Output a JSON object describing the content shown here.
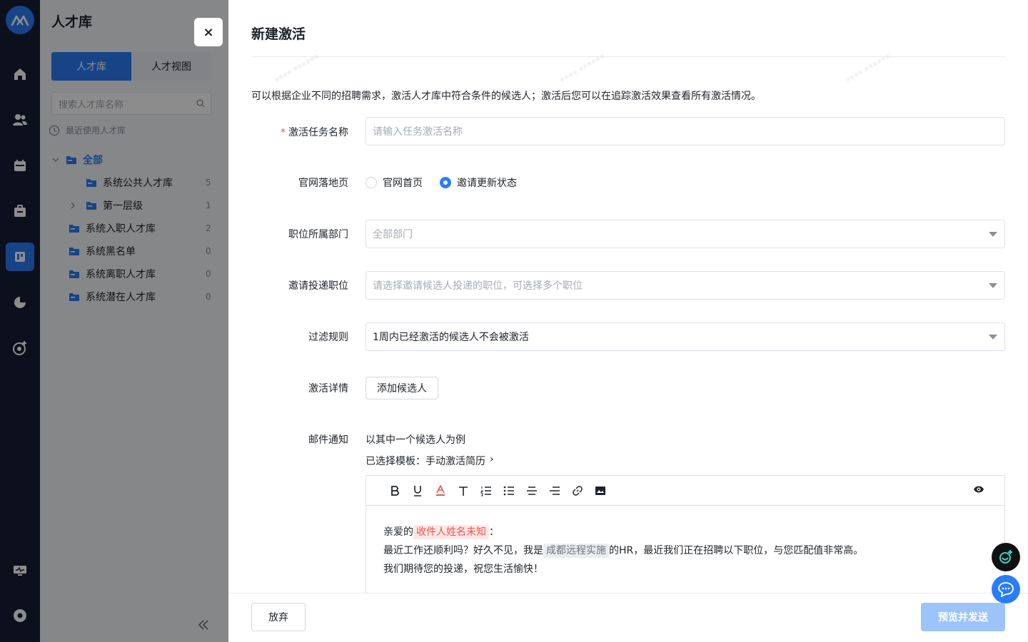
{
  "rail": {
    "items": [
      "home-icon",
      "users-icon",
      "calendar-icon",
      "briefcase-icon",
      "talent-library-icon",
      "pie-chart-icon",
      "target-icon"
    ],
    "active_index": 4,
    "bottom": [
      "monitor-icon",
      "settings-icon"
    ]
  },
  "sidebar": {
    "title": "人才库",
    "tabs": [
      "人才库",
      "人才视图"
    ],
    "active_tab": 0,
    "search_placeholder": "搜索人才库名称",
    "recent_label": "最近使用人才库",
    "tree": [
      {
        "label": "全部",
        "count": "",
        "selected": true,
        "level": 0
      },
      {
        "label": "系统公共人才库",
        "count": "5",
        "level": 1
      },
      {
        "label": "第一层级",
        "count": "1",
        "level": 1
      },
      {
        "label": "系统入职人才库",
        "count": "2",
        "level": 0
      },
      {
        "label": "系统黑名单",
        "count": "0",
        "level": 0
      },
      {
        "label": "系统离职人才库",
        "count": "0",
        "level": 0
      },
      {
        "label": "系统潜在人才库",
        "count": "0",
        "level": 0
      }
    ]
  },
  "drawer": {
    "close_label": "×",
    "title": "新建激活",
    "description": "可以根据企业不同的招聘需求，激活人才库中符合条件的候选人；激活后您可以在追踪激活效果查看所有激活情况。",
    "fields": {
      "task_name": {
        "label": "激活任务名称",
        "required": true,
        "placeholder": "请输入任务激活名称"
      },
      "landing": {
        "label": "官网落地页",
        "options": [
          "官网首页",
          "邀请更新状态"
        ],
        "selected": 1
      },
      "department": {
        "label": "职位所属部门",
        "value": "全部部门"
      },
      "positions": {
        "label": "邀请投递职位",
        "placeholder": "请选择邀请候选人投递的职位，可选择多个职位"
      },
      "filter": {
        "label": "过滤规则",
        "value": "1周内已经激活的候选人不会被激活"
      },
      "details": {
        "label": "激活详情",
        "button": "添加候选人"
      },
      "email": {
        "label": "邮件通知",
        "example_text": "以其中一个候选人为例",
        "template_text": "已选择模板：手动激活简历",
        "template_chevron": "›",
        "toolbar": [
          "bold-icon",
          "underline-icon",
          "font-color-icon",
          "text-size-icon",
          "ordered-list-icon",
          "bullet-list-icon",
          "align-center-icon",
          "align-right-icon",
          "link-icon",
          "image-icon"
        ],
        "preview_icon": "eye-icon",
        "body": {
          "line1_prefix": "亲爱的",
          "recipient_tag": "收件人姓名未知",
          "line1_suffix": "：",
          "line2_prefix": "最近工作还顺利吗？好久不见，我是",
          "company_tag": "成都远程实施",
          "line2_suffix": "的HR，最近我们正在招聘以下职位，与您匹配值非常高。",
          "line3": "我们期待您的投递，祝您生活愉快！"
        }
      }
    },
    "footer": {
      "cancel": "放弃",
      "submit": "预览并发送"
    }
  },
  "colors": {
    "accent": "#2b7df6",
    "rail_bg": "#161d33",
    "primary_disabled": "#9cc4fb",
    "required": "#f0544a"
  }
}
